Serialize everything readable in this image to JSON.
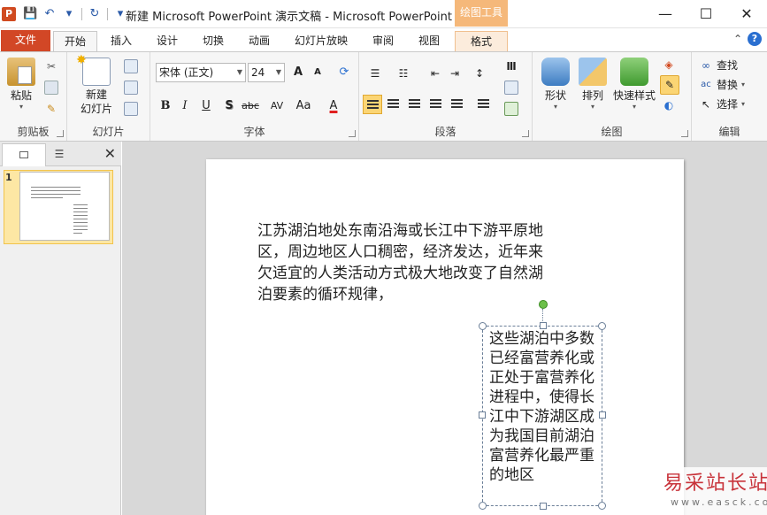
{
  "titlebar": {
    "app_icon": "P",
    "window_title": "新建 Microsoft PowerPoint 演示文稿 - Microsoft PowerPoint",
    "context_header": "绘图工具",
    "qat_icons": [
      "save-icon",
      "undo-icon",
      "redo-icon",
      "customize-icon"
    ],
    "controls": {
      "minimize": "—",
      "maximize": "☐",
      "close": "✕"
    }
  },
  "tabs": {
    "file": "文件",
    "items": [
      "开始",
      "插入",
      "设计",
      "切换",
      "动画",
      "幻灯片放映",
      "审阅",
      "视图",
      "格式"
    ],
    "collapse": "⌃",
    "help": "?"
  },
  "ribbon": {
    "clipboard": {
      "label": "剪贴板",
      "paste": "粘贴"
    },
    "slides": {
      "label": "幻灯片",
      "new_slide": "新建\n幻灯片"
    },
    "font": {
      "label": "字体",
      "font_name": "宋体 (正文)",
      "font_size": "24",
      "bold": "B",
      "italic": "I",
      "underline": "U",
      "shadow": "S",
      "strike": "abc",
      "spacing": "AV",
      "case": "Aa",
      "color": "A",
      "grow": "A",
      "shrink": "A"
    },
    "paragraph": {
      "label": "段落"
    },
    "drawing": {
      "label": "绘图",
      "shapes": "形状",
      "arrange": "排列",
      "quick_styles": "快速样式"
    },
    "editing": {
      "label": "编辑",
      "find": "查找",
      "replace": "替换",
      "select": "选择"
    }
  },
  "pane": {
    "slide_number": "1",
    "close": "✕"
  },
  "slide": {
    "paragraph1": "江苏湖泊地处东南沿海或长江中下游平原地区，周边地区人口稠密，经济发达，近年来欠适宜的人类活动方式极大地改变了自然湖泊要素的循环规律，",
    "paragraph2": "这些湖泊中多数已经富营养化或正处于富营养化进程中，使得长江中下游湖区成为我国目前湖泊富营养化最严重的地区"
  },
  "watermark": {
    "title": "易采站长站",
    "url": "www.easck.com"
  }
}
